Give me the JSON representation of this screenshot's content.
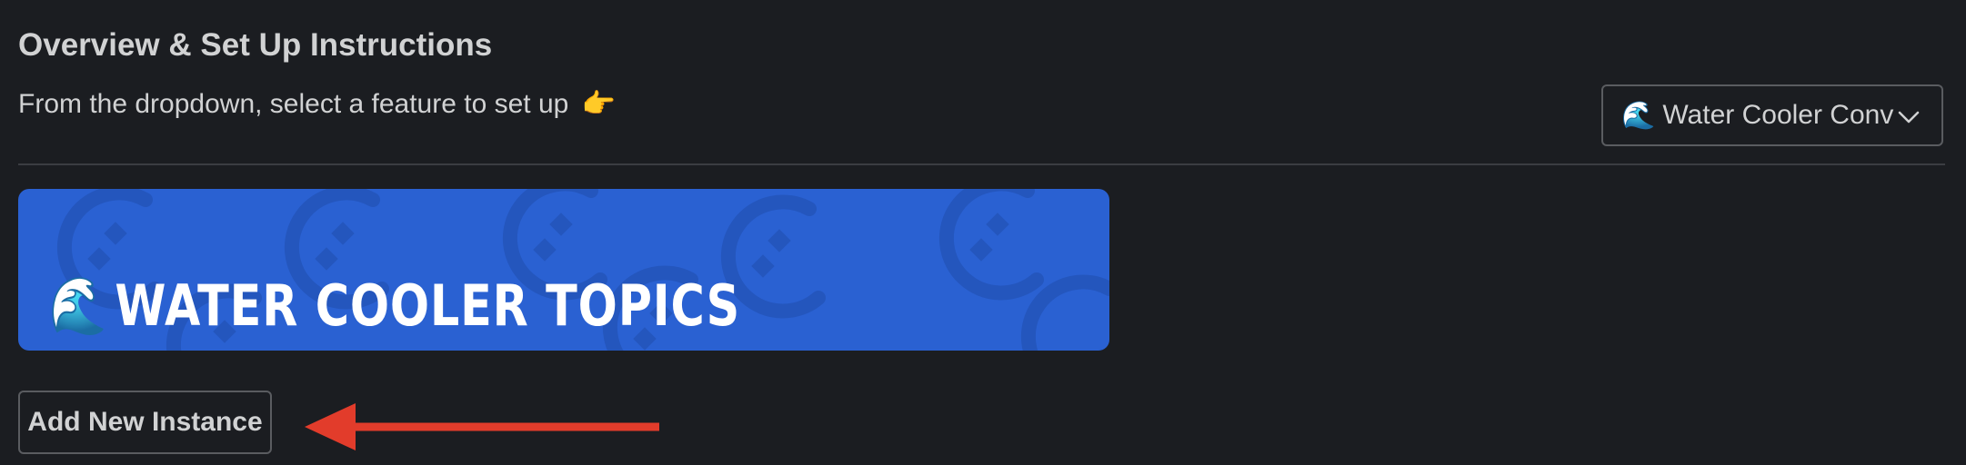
{
  "header": {
    "title": "Overview & Set Up Instructions",
    "subtitle": "From the dropdown, select a feature to set up",
    "subtitle_emoji": "👉"
  },
  "feature_dropdown": {
    "emoji": "🌊",
    "selected": "Water Cooler Conv",
    "icon": "chevron-down-icon"
  },
  "banner": {
    "emoji": "🌊",
    "title": "WATER COOLER TOPICS",
    "background": "#2a61d2"
  },
  "actions": {
    "add_instance_label": "Add New Instance"
  },
  "annotation": {
    "arrow_color": "#e23c2b"
  }
}
